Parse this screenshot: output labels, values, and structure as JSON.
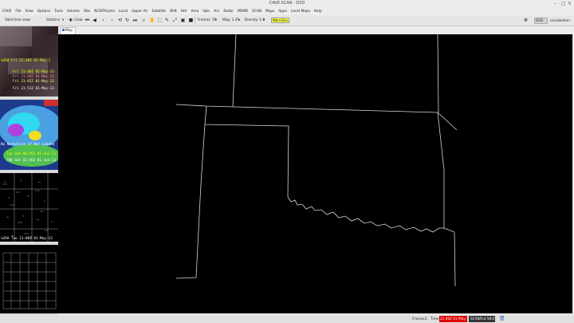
{
  "window": {
    "title": "CAVE:SCAN - D2D"
  },
  "menu": [
    "CAVE",
    "File",
    "View",
    "Options",
    "Tools",
    "Volume",
    "Obs",
    "NCEP/Hydro",
    "Local",
    "Upper Air",
    "Satellite",
    "Wdt",
    "Hdr",
    "Area",
    "Iabc",
    "Arc",
    "Radar",
    "MRMS",
    "SCAN",
    "Maps",
    "Apps",
    "Local Maps",
    "Help"
  ],
  "toolbar": {
    "time_select": "Valid time seq",
    "panel_select": "Stations",
    "clear_label": "Clear",
    "frames_label": "Frames: 10",
    "mag_label": "Mag: 1.25",
    "density_label": "Density: 1.0",
    "warngen_label": "WarnGen",
    "d2d_label": "D2D",
    "localization_label": "Localization"
  },
  "tab": {
    "label": "Map 11"
  },
  "thumbnails": [
    {
      "lines": [
        "%ZAH Fri 21:40Z 01-May-1",
        "Fri 21:40Z 01-May-13",
        "Fri 21:40Z 01-May-13",
        "Fri 21:45Z 01-May-13",
        "Fri 21:51Z 01-May-13"
      ]
    },
    {
      "lines": [
        "No Normalize of Not Loaded",
        "Tue Sat 00:45Z 01-Jun-13",
        "700 Sat 03:46Z 01-Jun-13"
      ]
    },
    {
      "lines": [
        "%ZAH Tue 21:00Z 01-May-13"
      ]
    },
    {
      "lines": []
    }
  ],
  "status": {
    "frames_label": "Frames:",
    "frames_value": "2",
    "time_label": "Time:",
    "time_value": "21:49Z 01-May-13",
    "scan_value": "SCAN/Fut 58:07"
  },
  "colors": {
    "map_line": "#d8d8d8",
    "time_box": "#e00000",
    "warngen": "#ffff55"
  }
}
